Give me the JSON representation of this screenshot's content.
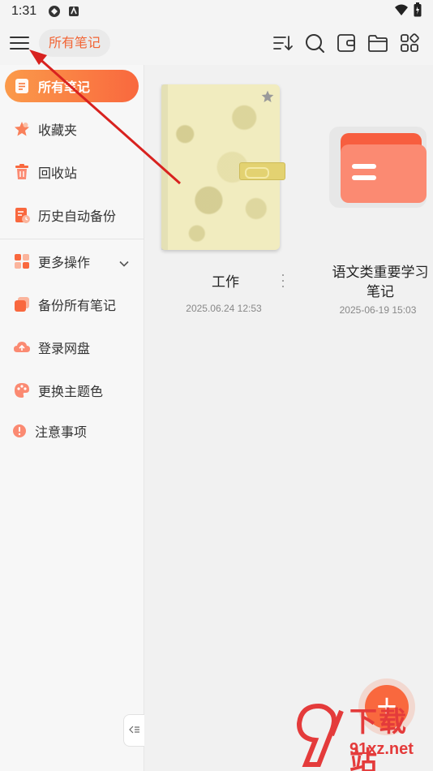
{
  "status_bar": {
    "time": "1:31"
  },
  "header": {
    "title": "所有笔记"
  },
  "sidebar": {
    "items": [
      {
        "label": "所有笔记",
        "active": true
      },
      {
        "label": "收藏夹"
      },
      {
        "label": "回收站"
      },
      {
        "label": "历史自动备份"
      },
      {
        "label": "更多操作"
      },
      {
        "label": "备份所有笔记"
      },
      {
        "label": "登录网盘"
      },
      {
        "label": "更换主题色"
      },
      {
        "label": "注意事项"
      }
    ]
  },
  "notes": [
    {
      "title": "工作",
      "date": "2025.06.24 12:53"
    },
    {
      "title_line1": "语文类重要学习",
      "title_line2": "笔记",
      "date": "2025-06-19 15:03"
    }
  ],
  "fab": {
    "label": "+"
  },
  "watermark": {
    "text": "下载站",
    "url": "91xz.net"
  },
  "colors": {
    "accent": "#f9683e",
    "accent_light": "#fb9a4a",
    "folder": "#f75e3f"
  }
}
